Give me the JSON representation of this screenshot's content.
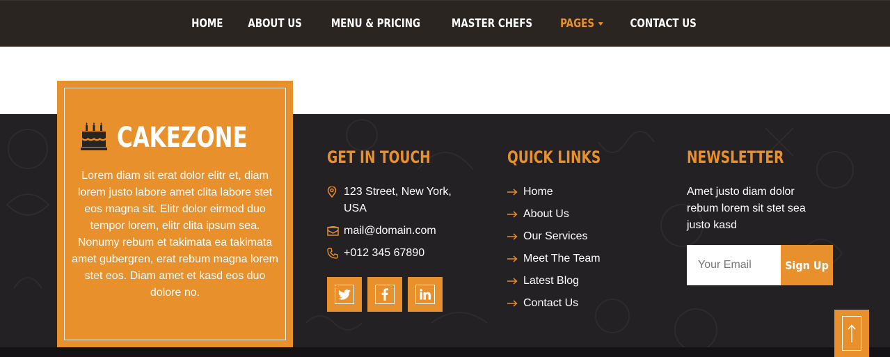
{
  "nav": {
    "items": [
      {
        "label": "HOME",
        "active": false
      },
      {
        "label": "ABOUT US",
        "active": false
      },
      {
        "label": "MENU & PRICING",
        "active": false
      },
      {
        "label": "MASTER CHEFS",
        "active": false
      },
      {
        "label": "PAGES",
        "active": true,
        "dropdown": true
      },
      {
        "label": "CONTACT US",
        "active": false
      }
    ]
  },
  "brand": {
    "name": "CAKEZONE",
    "icon": "birthday-cake-icon",
    "description": "Lorem diam sit erat dolor elitr et, diam lorem justo labore amet clita labore stet eos magna sit. Elitr dolor eirmod duo tempor lorem, elitr clita ipsum sea. Nonumy rebum et takimata ea takimata amet gubergren, erat rebum magna lorem stet eos. Diam amet et kasd eos duo dolore no."
  },
  "contact": {
    "title": "GET IN TOUCH",
    "address": "123 Street, New York, USA",
    "email": "mail@domain.com",
    "phone": "+012 345 67890",
    "social": [
      "twitter-icon",
      "facebook-icon",
      "linkedin-icon"
    ]
  },
  "quick_links": {
    "title": "QUICK LINKS",
    "items": [
      "Home",
      "About Us",
      "Our Services",
      "Meet The Team",
      "Latest Blog",
      "Contact Us"
    ]
  },
  "newsletter": {
    "title": "NEWSLETTER",
    "text": "Amet justo diam dolor rebum lorem sit stet sea justo kasd",
    "placeholder": "Your Email",
    "button": "Sign Up"
  },
  "colors": {
    "accent": "#e8902b",
    "nav_bg": "#2b2522",
    "footer_bg": "#242124"
  }
}
